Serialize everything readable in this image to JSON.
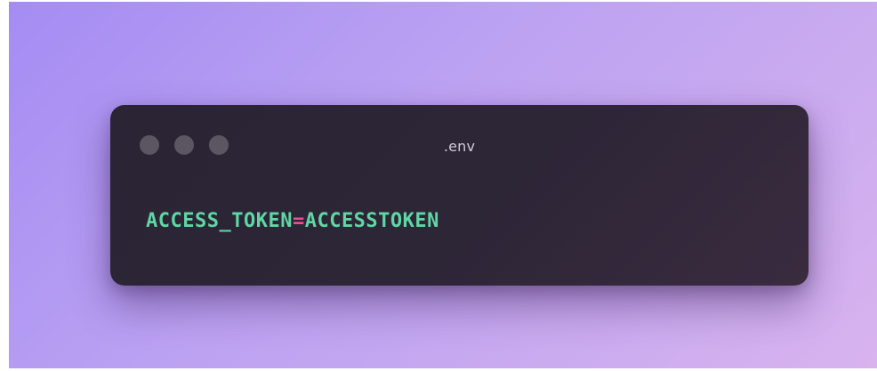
{
  "window": {
    "filename": ".env"
  },
  "code": {
    "key": "ACCESS_TOKEN",
    "operator": "=",
    "value": "ACCESSTOKEN"
  },
  "colors": {
    "key": "#5fd6a4",
    "operator": "#e8518f",
    "value": "#5fd6a4",
    "window_background": "#2b2535",
    "background_gradient_start": "#a48cf3",
    "background_gradient_end": "#d8b3ee"
  },
  "icons": {
    "window_controls": [
      "window-dot-icon",
      "window-dot-icon",
      "window-dot-icon"
    ]
  }
}
